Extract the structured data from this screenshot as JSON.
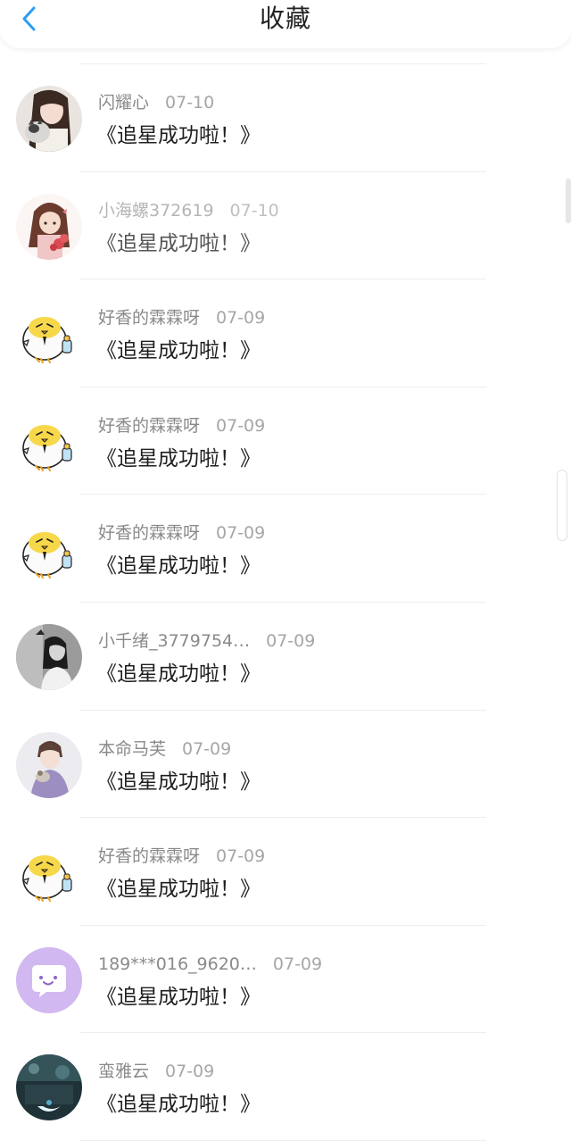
{
  "header": {
    "title": "收藏",
    "back_icon": "chevron-left-icon",
    "accent_color": "#2a9df4"
  },
  "items": [
    {
      "name": "闪耀心",
      "date": "07-10",
      "content": "《追星成功啦！》",
      "avatar": "photo-girl-with-cat"
    },
    {
      "name": "小海螺372619",
      "date": "07-10",
      "content": "《追星成功啦！》",
      "avatar": "cartoon-girl-flowers"
    },
    {
      "name": "好香的霖霖呀",
      "date": "07-09",
      "content": "《追星成功啦！》",
      "avatar": "cartoon-chick-bottle"
    },
    {
      "name": "好香的霖霖呀",
      "date": "07-09",
      "content": "《追星成功啦！》",
      "avatar": "cartoon-chick-bottle"
    },
    {
      "name": "好香的霖霖呀",
      "date": "07-09",
      "content": "《追星成功啦！》",
      "avatar": "cartoon-chick-bottle"
    },
    {
      "name": "小千绪_3779754…",
      "date": "07-09",
      "content": "《追星成功啦！》",
      "avatar": "photo-girl-grayscale"
    },
    {
      "name": "本命马芙",
      "date": "07-09",
      "content": "《追星成功啦！》",
      "avatar": "photo-boy-light"
    },
    {
      "name": "好香的霖霖呀",
      "date": "07-09",
      "content": "《追星成功啦！》",
      "avatar": "cartoon-chick-bottle"
    },
    {
      "name": "189***016_9620…",
      "date": "07-09",
      "content": "《追星成功啦！》",
      "avatar": "purple-chat-bubble"
    },
    {
      "name": "蛮雅云",
      "date": "07-09",
      "content": "《追星成功啦！》",
      "avatar": "photo-dark-night"
    }
  ]
}
